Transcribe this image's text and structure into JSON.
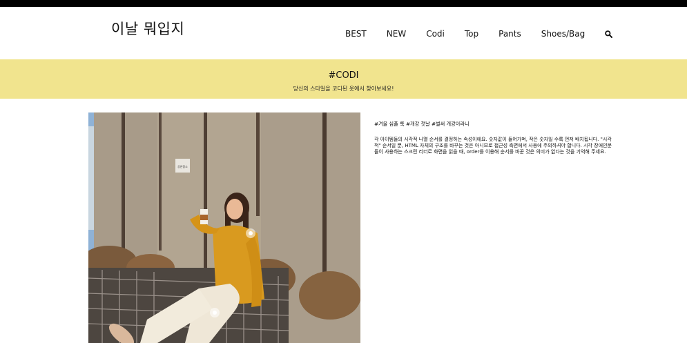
{
  "header": {
    "logo": "이날 뭐입지",
    "nav": [
      "BEST",
      "NEW",
      "Codi",
      "Top",
      "Pants",
      "Shoes/Bag"
    ],
    "search_icon": "search-icon"
  },
  "banner": {
    "title": "#CODI",
    "subtitle": "당신의 스타일을 코디된 옷에서 찾아보세요!"
  },
  "post": {
    "tags": "#겨울 심플 룩 #개강 첫날 #벌써 개강이라니",
    "body": "각 아이템들의 시각적 나열 순서를 결정하는 속성이에요. 숫자값이 들어가며, 작은 숫자일 수록 먼저 배치됩니다. \"시각적\" 순서일 뿐, HTML 자체의 구조를 바꾸는 것은 아니므로 접근성 측면에서 사용에 주의하셔야 합니다. 시각 장애인분들이 사용하는 스크린 리더로 화면을 읽을 때, order를 이용해 순서를 바꾼 것은 의미가 없다는 것을 기억해 주세요.",
    "photo_sign": "공연장소"
  },
  "colors": {
    "banner_bg": "#f1e48e",
    "sweater": "#d99a1f"
  }
}
